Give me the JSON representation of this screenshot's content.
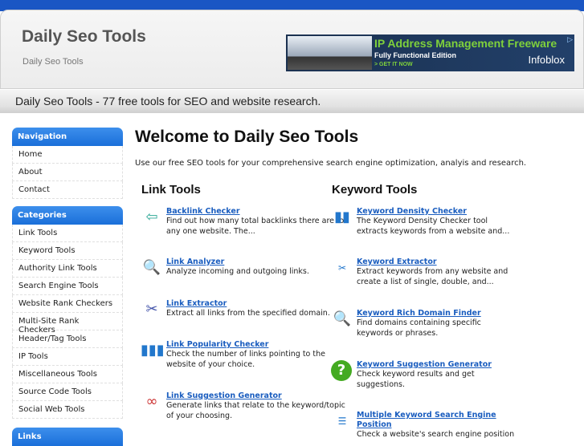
{
  "header": {
    "title": "Daily Seo Tools",
    "subtitle": "Daily Seo Tools",
    "tagline": "Daily Seo Tools - 77 free tools for SEO and website research."
  },
  "ad": {
    "headline": "IP Address Management Freeware",
    "sub": "Fully Functional Edition",
    "cta": "> GET IT NOW",
    "brand": "Infoblox"
  },
  "sidebar": {
    "navigation": {
      "title": "Navigation",
      "items": [
        "Home",
        "About",
        "Contact"
      ]
    },
    "categories": {
      "title": "Categories",
      "items": [
        "Link Tools",
        "Keyword Tools",
        "Authority Link Tools",
        "Search Engine Tools",
        "Website Rank Checkers",
        "Multi-Site Rank Checkers",
        "Header/Tag Tools",
        "IP Tools",
        "Miscellaneous Tools",
        "Source Code Tools",
        "Social Web Tools"
      ]
    },
    "links": {
      "title": "Links"
    }
  },
  "main": {
    "title": "Welcome to Daily Seo Tools",
    "intro": "Use our free SEO tools for your comprehensive search engine optimization, analyis and research.",
    "link_tools": {
      "title": "Link Tools",
      "items": [
        {
          "name": "Backlink Checker",
          "desc": "Find out how many total backlinks there are for any one website. The..."
        },
        {
          "name": "Link Analyzer",
          "desc": "Analyze incoming and outgoing links."
        },
        {
          "name": "Link Extractor",
          "desc": "Extract all links from the specified domain."
        },
        {
          "name": "Link Popularity Checker",
          "desc": "Check the number of links pointing to the website of your choice."
        },
        {
          "name": "Link Suggestion Generator",
          "desc": "Generate links that relate to the keyword/topic of your choosing."
        }
      ]
    },
    "keyword_tools": {
      "title": "Keyword Tools",
      "items": [
        {
          "name": "Keyword Density Checker",
          "desc": "The Keyword Density Checker tool extracts keywords from a website and..."
        },
        {
          "name": "Keyword Extractor",
          "desc": "Extract keywords from any website and create a list of single, double, and..."
        },
        {
          "name": "Keyword Rich Domain Finder",
          "desc": "Find domains containing specific keywords or phrases."
        },
        {
          "name": "Keyword Suggestion Generator",
          "desc": "Check keyword results and get suggestions."
        },
        {
          "name": "Multiple Keyword Search Engine Position",
          "desc": "Check a website's search engine position"
        }
      ]
    }
  }
}
